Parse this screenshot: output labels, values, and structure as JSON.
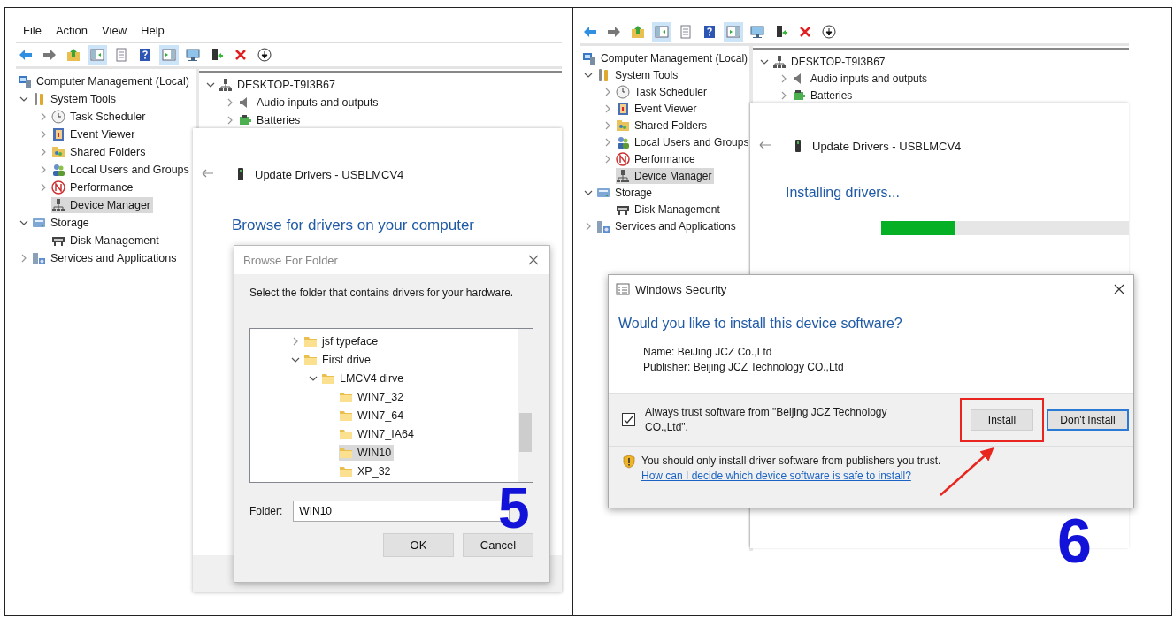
{
  "panels": [
    {
      "step": "5",
      "window": {
        "menu": [
          "File",
          "Action",
          "View",
          "Help"
        ],
        "toolbar": [
          {
            "kind": "back",
            "pressed": false
          },
          {
            "kind": "forward",
            "pressed": false
          },
          {
            "kind": "up",
            "pressed": false
          },
          {
            "kind": "tree",
            "pressed": true
          },
          {
            "kind": "props",
            "pressed": false
          },
          {
            "kind": "help",
            "pressed": false
          },
          {
            "kind": "pane",
            "pressed": true
          },
          {
            "kind": "monitor",
            "pressed": false
          },
          {
            "kind": "update",
            "pressed": false
          },
          {
            "kind": "delete",
            "pressed": false
          },
          {
            "kind": "download",
            "pressed": false
          }
        ],
        "tree": [
          {
            "label": "Computer Management (Local)",
            "kind": "computer",
            "selected": false,
            "children": [
              {
                "label": "System Tools",
                "kind": "tools",
                "expanded": true,
                "selected": false,
                "children": [
                  {
                    "label": "Task Scheduler",
                    "kind": "clock",
                    "expanded": false,
                    "selected": false
                  },
                  {
                    "label": "Event Viewer",
                    "kind": "event",
                    "expanded": false,
                    "selected": false
                  },
                  {
                    "label": "Shared Folders",
                    "kind": "share",
                    "expanded": false,
                    "selected": false
                  },
                  {
                    "label": "Local Users and Groups",
                    "kind": "users",
                    "expanded": false,
                    "selected": false
                  },
                  {
                    "label": "Performance",
                    "kind": "perf",
                    "expanded": false,
                    "selected": false
                  },
                  {
                    "label": "Device Manager",
                    "kind": "device",
                    "selected": true
                  }
                ]
              },
              {
                "label": "Storage",
                "kind": "storage",
                "expanded": true,
                "selected": false,
                "children": [
                  {
                    "label": "Disk Management",
                    "kind": "disk",
                    "selected": false
                  }
                ]
              },
              {
                "label": "Services and Applications",
                "kind": "services",
                "expanded": false,
                "selected": false
              }
            ]
          }
        ],
        "devices": [
          {
            "label": "DESKTOP-T9I3B67",
            "kind": "device",
            "expanded": true,
            "selected": false,
            "children": [
              {
                "label": "Audio inputs and outputs",
                "kind": "speaker",
                "expanded": false,
                "selected": false
              },
              {
                "label": "Batteries",
                "kind": "battery",
                "expanded": false,
                "selected": false
              }
            ]
          }
        ]
      },
      "wizard": {
        "title": "Update Drivers - USBLMCV4",
        "heading": "Browse for drivers on your computer"
      },
      "browse_dialog": {
        "title": "Browse For Folder",
        "instruction": "Select the folder that contains drivers for your hardware.",
        "tree": [
          {
            "label": "jsf typeface",
            "kind": "folder",
            "expanded": false,
            "selected": false
          },
          {
            "label": "First drive",
            "kind": "folder",
            "expanded": true,
            "selected": false,
            "children": [
              {
                "label": "LMCV4 dirve",
                "kind": "folder",
                "expanded": true,
                "selected": false,
                "children": [
                  {
                    "label": "WIN7_32",
                    "kind": "folder",
                    "selected": false
                  },
                  {
                    "label": "WIN7_64",
                    "kind": "folder",
                    "selected": false
                  },
                  {
                    "label": "WIN7_IA64",
                    "kind": "folder",
                    "selected": false
                  },
                  {
                    "label": "WIN10",
                    "kind": "folder",
                    "selected": true
                  },
                  {
                    "label": "XP_32",
                    "kind": "folder",
                    "selected": false
                  }
                ]
              }
            ]
          }
        ],
        "folder_label": "Folder:",
        "folder_value": "WIN10",
        "buttons": [
          "OK",
          "Cancel"
        ]
      }
    },
    {
      "step": "6",
      "window": {
        "toolbar": [
          {
            "kind": "back",
            "pressed": false
          },
          {
            "kind": "forward",
            "pressed": false
          },
          {
            "kind": "up",
            "pressed": false
          },
          {
            "kind": "tree",
            "pressed": true
          },
          {
            "kind": "props",
            "pressed": false
          },
          {
            "kind": "help",
            "pressed": false
          },
          {
            "kind": "pane",
            "pressed": true
          },
          {
            "kind": "monitor",
            "pressed": false
          },
          {
            "kind": "update",
            "pressed": false
          },
          {
            "kind": "delete",
            "pressed": false
          },
          {
            "kind": "download",
            "pressed": false
          }
        ],
        "tree": [
          {
            "label": "Computer Management (Local)",
            "kind": "computer",
            "selected": false,
            "children": [
              {
                "label": "System Tools",
                "kind": "tools",
                "expanded": true,
                "selected": false,
                "children": [
                  {
                    "label": "Task Scheduler",
                    "kind": "clock",
                    "expanded": false,
                    "selected": false
                  },
                  {
                    "label": "Event Viewer",
                    "kind": "event",
                    "expanded": false,
                    "selected": false
                  },
                  {
                    "label": "Shared Folders",
                    "kind": "share",
                    "expanded": false,
                    "selected": false
                  },
                  {
                    "label": "Local Users and Groups",
                    "kind": "users",
                    "expanded": false,
                    "selected": false
                  },
                  {
                    "label": "Performance",
                    "kind": "perf",
                    "expanded": false,
                    "selected": false
                  },
                  {
                    "label": "Device Manager",
                    "kind": "device",
                    "selected": true
                  }
                ]
              },
              {
                "label": "Storage",
                "kind": "storage",
                "expanded": true,
                "selected": false,
                "children": [
                  {
                    "label": "Disk Management",
                    "kind": "disk",
                    "selected": false
                  }
                ]
              },
              {
                "label": "Services and Applications",
                "kind": "services",
                "expanded": false,
                "selected": false
              }
            ]
          }
        ],
        "devices": [
          {
            "label": "DESKTOP-T9I3B67",
            "kind": "device",
            "expanded": true,
            "selected": false,
            "children": [
              {
                "label": "Audio inputs and outputs",
                "kind": "speaker",
                "expanded": false,
                "selected": false
              },
              {
                "label": "Batteries",
                "kind": "battery",
                "expanded": false,
                "selected": false
              }
            ]
          }
        ]
      },
      "wizard": {
        "title": "Update Drivers - USBLMCV4",
        "status": "Installing drivers...",
        "progress": {
          "level": 0.3
        }
      },
      "security_dialog": {
        "title": "Windows Security",
        "heading": "Would you like to install this device software?",
        "name": "Name: BeiJing JCZ Co.,Ltd",
        "publisher": "Publisher: Beijing JCZ Technology CO.,Ltd",
        "trust": {
          "label": "Always trust software from \"Beijing JCZ Technology CO.,Ltd\".",
          "checked": true
        },
        "buttons": [
          {
            "label": "Install",
            "focused": false,
            "annotated": true
          },
          {
            "label": "Don't Install",
            "focused": true,
            "annotated": false
          }
        ],
        "warning": "You should only install driver software from publishers you trust.",
        "link": "How can I decide which device software is safe to install?"
      }
    }
  ]
}
